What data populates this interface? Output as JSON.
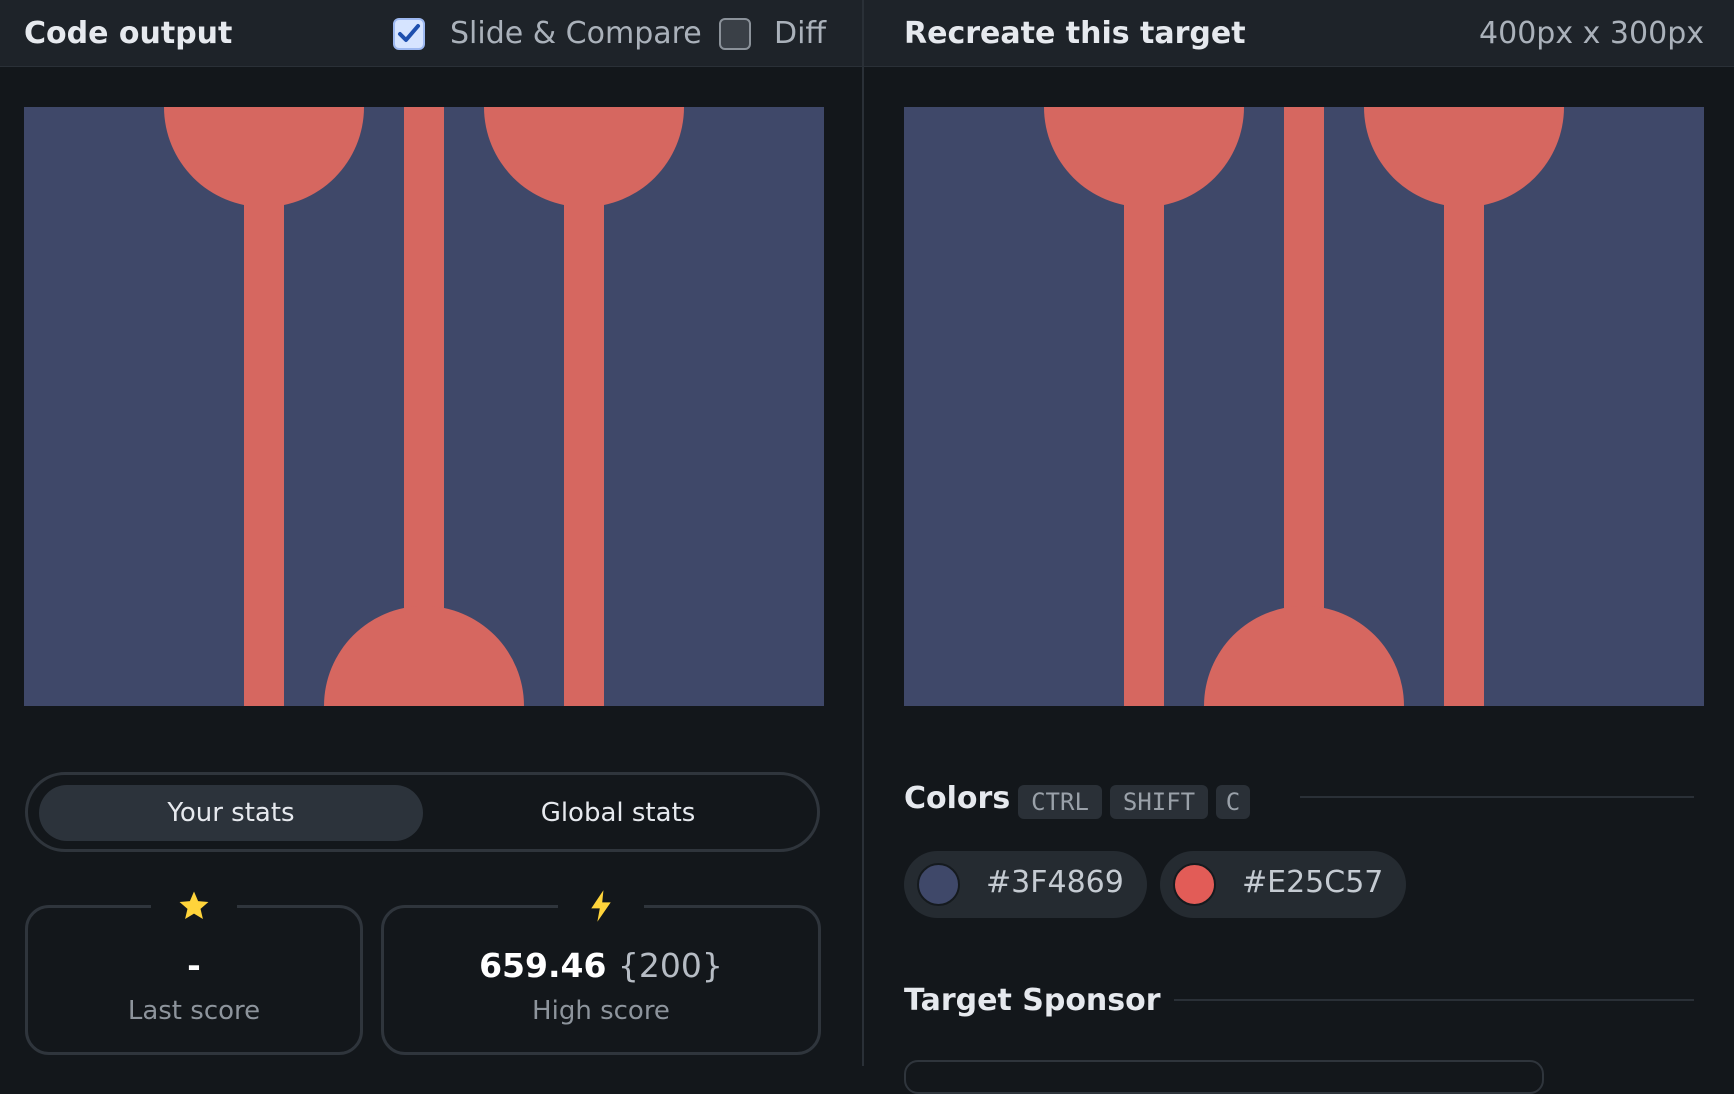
{
  "left": {
    "title": "Code output",
    "slide_compare_label": "Slide & Compare",
    "slide_compare_checked": true,
    "diff_label": "Diff",
    "diff_checked": false
  },
  "right": {
    "title": "Recreate this target",
    "size": "400px x 300px"
  },
  "stats": {
    "tab_your": "Your stats",
    "tab_global": "Global stats",
    "last_icon": "star-icon",
    "last_value": "-",
    "last_label": "Last score",
    "high_icon": "lightning-icon",
    "high_value": "659.46",
    "high_extra": "{200}",
    "high_label": "High score"
  },
  "colors": {
    "title": "Colors",
    "shortcut": [
      "CTRL",
      "SHIFT",
      "C"
    ],
    "list": [
      "#3F4869",
      "#E25C57"
    ]
  },
  "sponsor": {
    "title": "Target Sponsor"
  },
  "theme": {
    "background": "#13171b",
    "panel_header": "#1e2329",
    "accent_checkbox": "#d6e4ff",
    "star": "#ffd43b",
    "bolt": "#ffd43b"
  }
}
